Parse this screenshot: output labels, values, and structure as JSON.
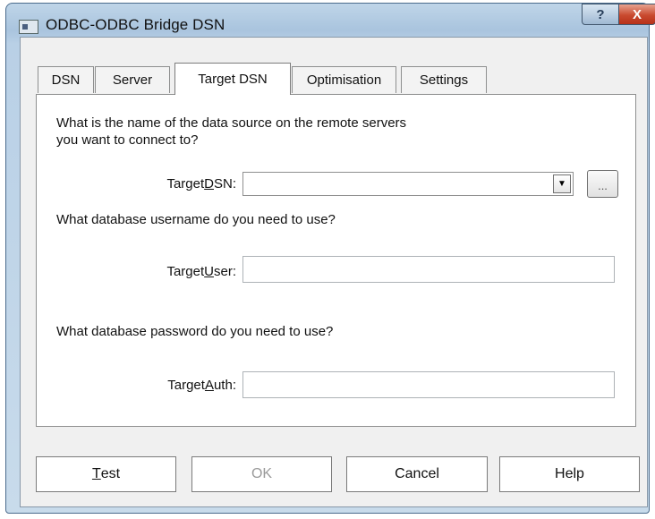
{
  "window": {
    "title": "ODBC-ODBC Bridge DSN"
  },
  "title_buttons": {
    "help": "?",
    "close": "X"
  },
  "tabs": [
    {
      "label": "DSN"
    },
    {
      "label": "Server"
    },
    {
      "label": "Target DSN"
    },
    {
      "label": "Optimisation"
    },
    {
      "label": "Settings"
    }
  ],
  "active_tab": "Target DSN",
  "target_dsn": {
    "question": "What is the name of the data source on the remote servers\nyou want to connect to?",
    "label_prefix": "Target",
    "label_mnemonic": "D",
    "label_suffix": "SN:",
    "value": "",
    "browse_label": "..."
  },
  "target_user": {
    "question": "What database username do you need to use?",
    "label_prefix": "Target",
    "label_mnemonic": "U",
    "label_suffix": "ser:",
    "value": ""
  },
  "target_auth": {
    "question": "What database password do you need to use?",
    "label_prefix": "Target",
    "label_mnemonic": "A",
    "label_suffix": "uth:",
    "value": ""
  },
  "buttons": {
    "test_mnemonic": "T",
    "test_rest": "est",
    "ok": "OK",
    "cancel": "Cancel",
    "help": "Help"
  }
}
